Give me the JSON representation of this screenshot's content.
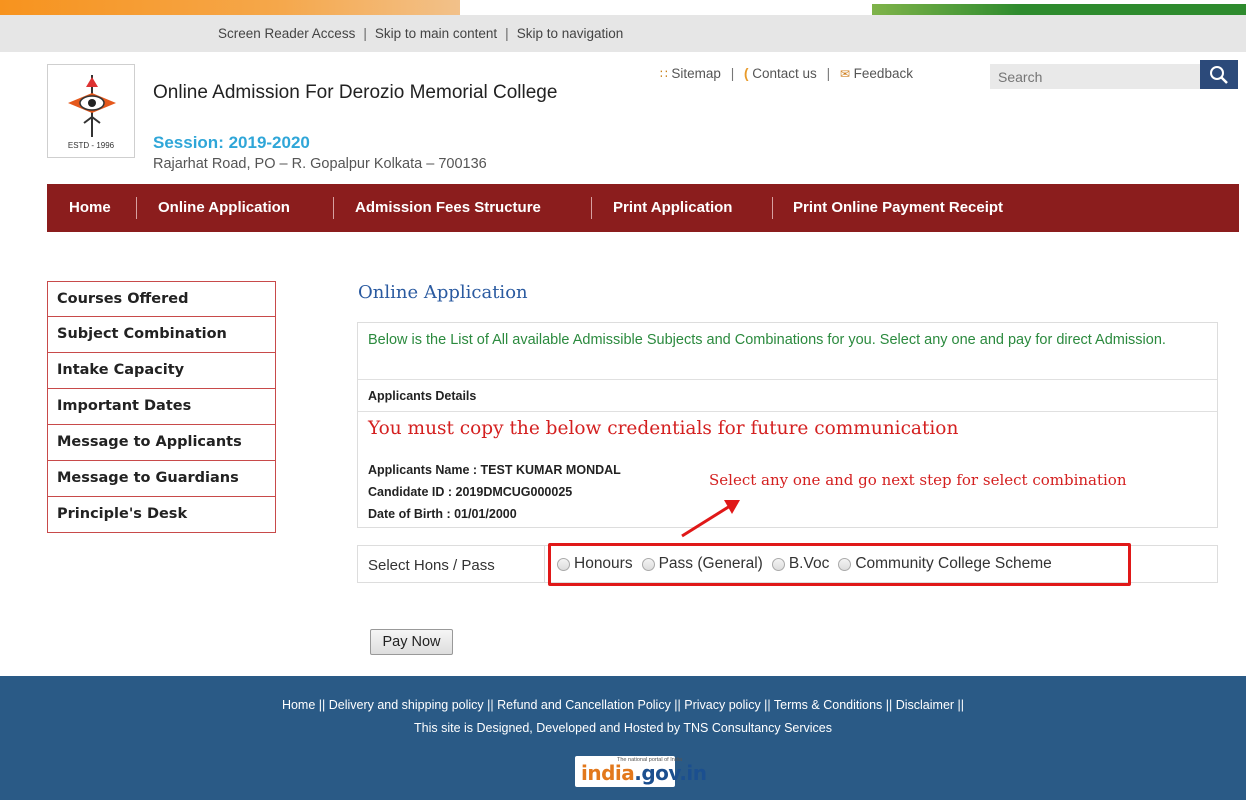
{
  "access_bar": {
    "screen_reader": "Screen Reader Access",
    "skip_main": "Skip to main content",
    "skip_nav": "Skip to navigation",
    "separator": "|"
  },
  "header": {
    "logo_text": "ESTD - 1996",
    "title": "Online Admission For Derozio Memorial College",
    "session": "Session: 2019-2020",
    "address": "Rajarhat Road, PO – R. Gopalpur Kolkata – 700136"
  },
  "top_links": {
    "sitemap": "Sitemap",
    "contact": "Contact us",
    "feedback": "Feedback",
    "sitemap_icon": "sitemap-icon",
    "contact_icon": "phone-icon",
    "feedback_icon": "mail-icon"
  },
  "search": {
    "placeholder": "Search",
    "icon": "search-icon"
  },
  "nav": {
    "items": [
      {
        "label": "Home"
      },
      {
        "label": "Online Application"
      },
      {
        "label": "Admission Fees Structure"
      },
      {
        "label": "Print Application"
      },
      {
        "label": "Print Online Payment Receipt"
      }
    ]
  },
  "sidebar": {
    "items": [
      {
        "label": "Courses Offered"
      },
      {
        "label": "Subject Combination"
      },
      {
        "label": "Intake Capacity"
      },
      {
        "label": "Important Dates"
      },
      {
        "label": "Message to Applicants"
      },
      {
        "label": "Message to Guardians"
      },
      {
        "label": "Principle's Desk"
      }
    ]
  },
  "main": {
    "title": "Online Application",
    "intro": "Below is the List of All available Admissible Subjects and Combinations for you. Select any one and pay for direct Admission.",
    "details_heading": "Applicants Details",
    "warning": "You must copy the below credentials for future communication",
    "applicant_name": "Applicants Name : TEST KUMAR MONDAL",
    "candidate_id": "Candidate ID : 2019DMCUG000025",
    "dob": "Date of Birth : 01/01/2000",
    "annotation": "Select any one and go next step for select combination",
    "select_label": "Select Hons / Pass",
    "options": [
      {
        "label": "Honours"
      },
      {
        "label": "Pass (General)"
      },
      {
        "label": "B.Voc"
      },
      {
        "label": "Community College Scheme"
      }
    ],
    "pay_button": "Pay Now"
  },
  "footer": {
    "links": "Home || Delivery and shipping policy || Refund and Cancellation Policy || Privacy policy || Terms & Conditions || Disclaimer ||",
    "credit": "This site is Designed, Developed and Hosted by TNS Consultancy Services",
    "india_tagline": "The national portal of India",
    "india_name_1": "india",
    "india_name_2": ".gov.in"
  },
  "colors": {
    "nav_bg": "#8b1d1d",
    "footer_bg": "#2a5a86",
    "accent_red": "#e01818",
    "intro_green": "#2b8a3e",
    "session_blue": "#2fa6d8"
  }
}
